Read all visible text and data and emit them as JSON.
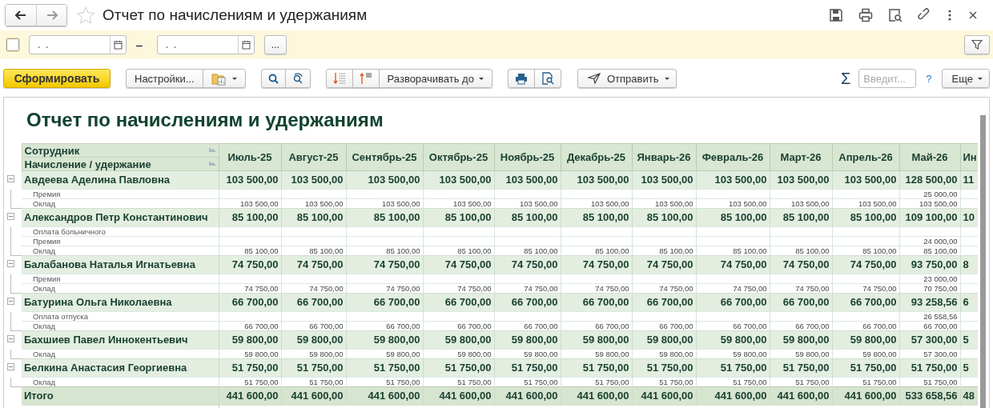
{
  "window": {
    "title": "Отчет по начислениям и удержаниям",
    "favorite": false
  },
  "filter_bar": {
    "enabled": {
      "checked": false
    },
    "date_from": {
      "value": ".  ."
    },
    "dash": "–",
    "date_to": {
      "value": ".  ."
    },
    "more_button": "..."
  },
  "command_bar": {
    "generate_button": "Сформировать",
    "settings_button": "Настройки...",
    "expand_button": "Разворачивать до",
    "send_button": "Отправить",
    "sum_sign": "Σ",
    "sum_field": {
      "placeholder": "Введит..."
    },
    "help": "?",
    "more_button": "Еще"
  },
  "report": {
    "title": "Отчет по начислениям и удержаниям",
    "row_headers": [
      "Сотрудник",
      "Начисление / удержание"
    ],
    "columns": [
      "Июль-25",
      "Август-25",
      "Сентябрь-25",
      "Октябрь-25",
      "Ноябрь-25",
      "Декабрь-25",
      "Январь-26",
      "Февраль-26",
      "Март-26",
      "Апрель-26",
      "Май-26",
      "Ин"
    ],
    "groups": [
      {
        "name": "Авдеева Аделина Павловна",
        "expanded": true,
        "values": [
          "103 500,00",
          "103 500,00",
          "103 500,00",
          "103 500,00",
          "103 500,00",
          "103 500,00",
          "103 500,00",
          "103 500,00",
          "103 500,00",
          "103 500,00",
          "128 500,00",
          "11"
        ],
        "items": [
          {
            "name": "Премия",
            "cells": [
              {
                "empty": true
              },
              {
                "empty": true
              },
              {
                "empty": true
              },
              {
                "empty": true
              },
              {
                "empty": true
              },
              {
                "empty": true
              },
              {
                "empty": true
              },
              {
                "empty": true
              },
              {
                "empty": true
              },
              {
                "empty": true
              },
              {
                "value": "25 000,00"
              },
              {
                "empty": true
              }
            ]
          },
          {
            "name": "Оклад",
            "cells": [
              {
                "value": "103 500,00"
              },
              {
                "value": "103 500,00"
              },
              {
                "value": "103 500,00"
              },
              {
                "value": "103 500,00"
              },
              {
                "value": "103 500,00"
              },
              {
                "value": "103 500,00"
              },
              {
                "value": "103 500,00"
              },
              {
                "value": "103 500,00"
              },
              {
                "value": "103 500,00"
              },
              {
                "value": "103 500,00"
              },
              {
                "value": "103 500,00"
              },
              {
                "empty": true
              }
            ]
          }
        ]
      },
      {
        "name": "Александров Петр Константинович",
        "expanded": true,
        "values": [
          "85 100,00",
          "85 100,00",
          "85 100,00",
          "85 100,00",
          "85 100,00",
          "85 100,00",
          "85 100,00",
          "85 100,00",
          "85 100,00",
          "85 100,00",
          "109 100,00",
          "10"
        ],
        "items": [
          {
            "name": "Оплата больничного",
            "cells": [
              {
                "empty": true
              },
              {
                "empty": true
              },
              {
                "empty": true
              },
              {
                "empty": true
              },
              {
                "empty": true
              },
              {
                "empty": true
              },
              {
                "empty": true
              },
              {
                "empty": true
              },
              {
                "empty": true
              },
              {
                "empty": true
              },
              {
                "empty": true
              },
              {
                "empty": true
              }
            ]
          },
          {
            "name": "Премия",
            "cells": [
              {
                "empty": true
              },
              {
                "empty": true
              },
              {
                "empty": true
              },
              {
                "empty": true
              },
              {
                "empty": true
              },
              {
                "empty": true
              },
              {
                "empty": true
              },
              {
                "empty": true
              },
              {
                "empty": true
              },
              {
                "empty": true
              },
              {
                "value": "24 000,00"
              },
              {
                "empty": true
              }
            ]
          },
          {
            "name": "Оклад",
            "cells": [
              {
                "value": "85 100,00"
              },
              {
                "value": "85 100,00"
              },
              {
                "value": "85 100,00"
              },
              {
                "value": "85 100,00"
              },
              {
                "value": "85 100,00"
              },
              {
                "value": "85 100,00"
              },
              {
                "value": "85 100,00"
              },
              {
                "value": "85 100,00"
              },
              {
                "value": "85 100,00"
              },
              {
                "value": "85 100,00"
              },
              {
                "value": "85 100,00"
              },
              {
                "empty": true
              }
            ]
          }
        ]
      },
      {
        "name": "Балабанова Наталья Игнатьевна",
        "expanded": true,
        "values": [
          "74 750,00",
          "74 750,00",
          "74 750,00",
          "74 750,00",
          "74 750,00",
          "74 750,00",
          "74 750,00",
          "74 750,00",
          "74 750,00",
          "74 750,00",
          "93 750,00",
          "8"
        ],
        "items": [
          {
            "name": "Премия",
            "cells": [
              {
                "empty": true
              },
              {
                "empty": true
              },
              {
                "empty": true
              },
              {
                "empty": true
              },
              {
                "empty": true
              },
              {
                "empty": true
              },
              {
                "empty": true
              },
              {
                "empty": true
              },
              {
                "empty": true
              },
              {
                "empty": true
              },
              {
                "value": "23 000,00"
              },
              {
                "empty": true
              }
            ]
          },
          {
            "name": "Оклад",
            "cells": [
              {
                "value": "74 750,00"
              },
              {
                "value": "74 750,00"
              },
              {
                "value": "74 750,00"
              },
              {
                "value": "74 750,00"
              },
              {
                "value": "74 750,00"
              },
              {
                "value": "74 750,00"
              },
              {
                "value": "74 750,00"
              },
              {
                "value": "74 750,00"
              },
              {
                "value": "74 750,00"
              },
              {
                "value": "74 750,00"
              },
              {
                "value": "70 750,00"
              },
              {
                "empty": true
              }
            ]
          }
        ]
      },
      {
        "name": "Батурина Ольга Николаевна",
        "expanded": true,
        "values": [
          "66 700,00",
          "66 700,00",
          "66 700,00",
          "66 700,00",
          "66 700,00",
          "66 700,00",
          "66 700,00",
          "66 700,00",
          "66 700,00",
          "66 700,00",
          "93 258,56",
          "6"
        ],
        "items": [
          {
            "name": "Оплата отпуска",
            "cells": [
              {
                "empty": true
              },
              {
                "empty": true
              },
              {
                "empty": true
              },
              {
                "empty": true
              },
              {
                "empty": true
              },
              {
                "empty": true
              },
              {
                "empty": true
              },
              {
                "empty": true
              },
              {
                "empty": true
              },
              {
                "empty": true
              },
              {
                "value": "26 558,56"
              },
              {
                "empty": true
              }
            ]
          },
          {
            "name": "Оклад",
            "cells": [
              {
                "value": "66 700,00"
              },
              {
                "value": "66 700,00"
              },
              {
                "value": "66 700,00"
              },
              {
                "value": "66 700,00"
              },
              {
                "value": "66 700,00"
              },
              {
                "value": "66 700,00"
              },
              {
                "value": "66 700,00"
              },
              {
                "value": "66 700,00"
              },
              {
                "value": "66 700,00"
              },
              {
                "value": "66 700,00"
              },
              {
                "value": "66 700,00"
              },
              {
                "empty": true
              }
            ]
          }
        ]
      },
      {
        "name": "Бахшиев Павел Иннокентьевич",
        "expanded": true,
        "values": [
          "59 800,00",
          "59 800,00",
          "59 800,00",
          "59 800,00",
          "59 800,00",
          "59 800,00",
          "59 800,00",
          "59 800,00",
          "59 800,00",
          "59 800,00",
          "57 300,00",
          "5"
        ],
        "items": [
          {
            "name": "Оклад",
            "cells": [
              {
                "value": "59 800,00"
              },
              {
                "value": "59 800,00"
              },
              {
                "value": "59 800,00"
              },
              {
                "value": "59 800,00"
              },
              {
                "value": "59 800,00"
              },
              {
                "value": "59 800,00"
              },
              {
                "value": "59 800,00"
              },
              {
                "value": "59 800,00"
              },
              {
                "value": "59 800,00"
              },
              {
                "value": "59 800,00"
              },
              {
                "value": "57 300,00"
              },
              {
                "empty": true
              }
            ]
          }
        ]
      },
      {
        "name": "Белкина Анастасия Георгиевна",
        "expanded": true,
        "values": [
          "51 750,00",
          "51 750,00",
          "51 750,00",
          "51 750,00",
          "51 750,00",
          "51 750,00",
          "51 750,00",
          "51 750,00",
          "51 750,00",
          "51 750,00",
          "51 750,00",
          "5"
        ],
        "items": [
          {
            "name": "Оклад",
            "cells": [
              {
                "value": "51 750,00"
              },
              {
                "value": "51 750,00"
              },
              {
                "value": "51 750,00"
              },
              {
                "value": "51 750,00"
              },
              {
                "value": "51 750,00"
              },
              {
                "value": "51 750,00"
              },
              {
                "value": "51 750,00"
              },
              {
                "value": "51 750,00"
              },
              {
                "value": "51 750,00"
              },
              {
                "value": "51 750,00"
              },
              {
                "value": "51 750,00"
              },
              {
                "empty": true
              }
            ]
          }
        ]
      }
    ],
    "total": {
      "label": "Итого",
      "values": [
        "441 600,00",
        "441 600,00",
        "441 600,00",
        "441 600,00",
        "441 600,00",
        "441 600,00",
        "441 600,00",
        "441 600,00",
        "441 600,00",
        "441 600,00",
        "533 658,56",
        "48"
      ]
    }
  }
}
